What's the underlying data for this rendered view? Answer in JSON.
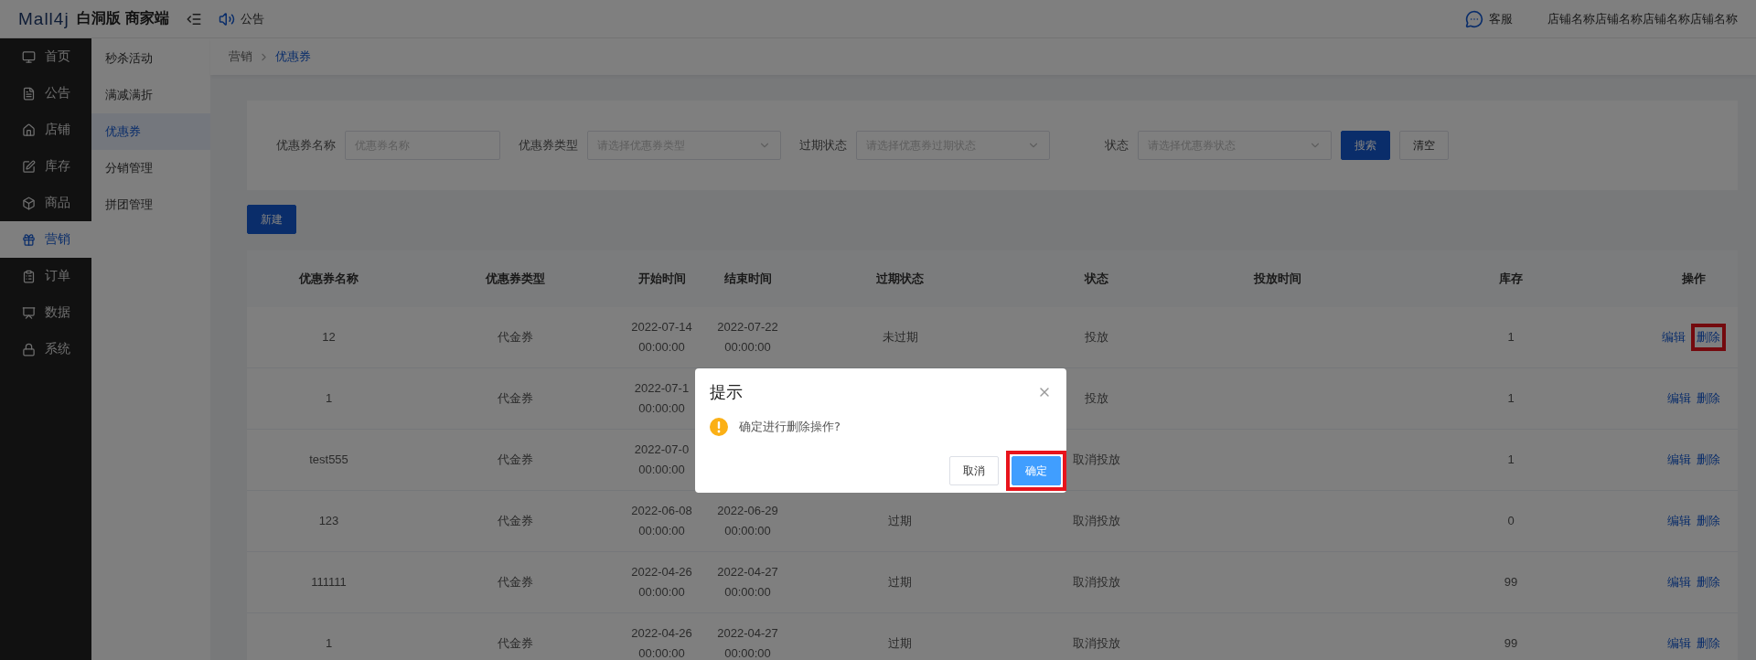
{
  "header": {
    "logo": "Mall4j",
    "edition": "白洞版 商家端",
    "notice": "公告",
    "service": "客服",
    "store_name": "店铺名称店铺名称店铺名称店铺名称"
  },
  "sidebar": {
    "items": [
      {
        "label": "首页",
        "selected": false
      },
      {
        "label": "公告",
        "selected": false
      },
      {
        "label": "店铺",
        "selected": false
      },
      {
        "label": "库存",
        "selected": false
      },
      {
        "label": "商品",
        "selected": false
      },
      {
        "label": "营销",
        "selected": true
      },
      {
        "label": "订单",
        "selected": false
      },
      {
        "label": "数据",
        "selected": false
      },
      {
        "label": "系统",
        "selected": false
      }
    ]
  },
  "submenu": {
    "items": [
      {
        "label": "秒杀活动",
        "selected": false
      },
      {
        "label": "满减满折",
        "selected": false
      },
      {
        "label": "优惠券",
        "selected": true
      },
      {
        "label": "分销管理",
        "selected": false
      },
      {
        "label": "拼团管理",
        "selected": false
      }
    ]
  },
  "breadcrumb": [
    "营销",
    "优惠券"
  ],
  "filters": [
    {
      "kind": "input",
      "label": "优惠券名称",
      "placeholder": "优惠券名称"
    },
    {
      "kind": "select",
      "label": "优惠券类型",
      "placeholder": "请选择优惠券类型"
    },
    {
      "kind": "select",
      "label": "过期状态",
      "placeholder": "请选择优惠券过期状态"
    },
    {
      "kind": "select",
      "label": "状态",
      "placeholder": "请选择优惠券状态"
    }
  ],
  "filter_buttons": [
    {
      "label": "搜索",
      "kind": "primary"
    },
    {
      "label": "清空",
      "kind": "default"
    }
  ],
  "new_button": "新建",
  "table": {
    "columns": [
      "优惠券名称",
      "优惠券类型",
      "开始时间",
      "结束时间",
      "过期状态",
      "状态",
      "投放时间",
      "库存",
      "操作"
    ],
    "rows": [
      {
        "cells": [
          "12",
          "代金券",
          "2022-07-14 00:00:00",
          "2022-07-22 00:00:00",
          "未过期",
          "投放",
          null,
          "1"
        ],
        "actions": [
          {
            "label": "编辑",
            "highlighted": false
          },
          {
            "label": "删除",
            "highlighted": true
          }
        ]
      },
      {
        "cells": [
          "1",
          "代金券",
          "2022-07-1 00:00:00",
          null,
          null,
          "投放",
          null,
          "1"
        ],
        "actions": [
          {
            "label": "编辑",
            "highlighted": false
          },
          {
            "label": "删除",
            "highlighted": false
          }
        ]
      },
      {
        "cells": [
          "test555",
          "代金券",
          "2022-07-0 00:00:00",
          null,
          null,
          "取消投放",
          null,
          "1"
        ],
        "actions": [
          {
            "label": "编辑",
            "highlighted": false
          },
          {
            "label": "删除",
            "highlighted": false
          }
        ]
      },
      {
        "cells": [
          "123",
          "代金券",
          "2022-06-08 00:00:00",
          "2022-06-29 00:00:00",
          "过期",
          "取消投放",
          null,
          "0"
        ],
        "actions": [
          {
            "label": "编辑",
            "highlighted": false
          },
          {
            "label": "删除",
            "highlighted": false
          }
        ]
      },
      {
        "cells": [
          "111111",
          "代金券",
          "2022-04-26 00:00:00",
          "2022-04-27 00:00:00",
          "过期",
          "取消投放",
          null,
          "99"
        ],
        "actions": [
          {
            "label": "编辑",
            "highlighted": false
          },
          {
            "label": "删除",
            "highlighted": false
          }
        ]
      },
      {
        "cells": [
          "1",
          "代金券",
          "2022-04-26 00:00:00",
          "2022-04-27 00:00:00",
          "过期",
          "取消投放",
          null,
          "99"
        ],
        "actions": [
          {
            "label": "编辑",
            "highlighted": false
          },
          {
            "label": "删除",
            "highlighted": false
          }
        ]
      }
    ]
  },
  "dialog": {
    "title": "提示",
    "message": "确定进行删除操作?",
    "buttons": [
      {
        "label": "取消",
        "kind": "default",
        "highlighted": false
      },
      {
        "label": "确定",
        "kind": "primary",
        "highlighted": true
      }
    ]
  }
}
